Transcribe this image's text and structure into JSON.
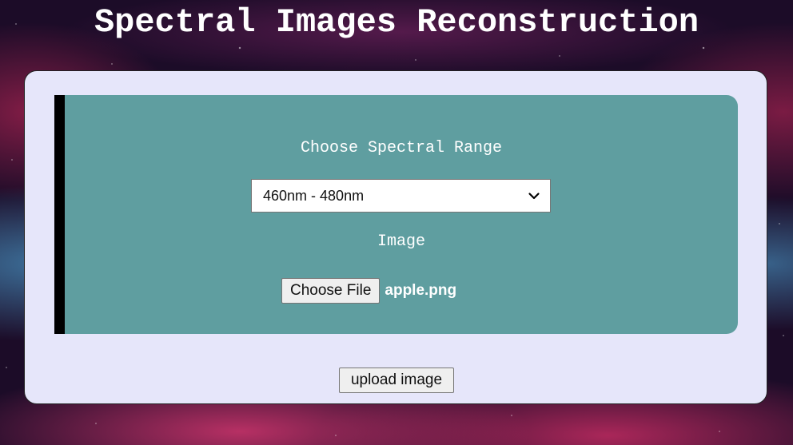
{
  "page": {
    "title": "Spectral Images Reconstruction"
  },
  "form": {
    "range_label": "Choose Spectral Range",
    "range_select": {
      "selected": "460nm - 480nm"
    },
    "image_label": "Image",
    "file_input": {
      "button_label": "Choose File",
      "file_name": "apple.png"
    },
    "submit_label": "upload image"
  },
  "icons": {
    "select_arrow": "chevron-down-icon"
  },
  "colors": {
    "card_background": "#e6e6fa",
    "panel_background": "#5f9ea0",
    "panel_accent": "#000000",
    "text_light": "#ffffff"
  }
}
